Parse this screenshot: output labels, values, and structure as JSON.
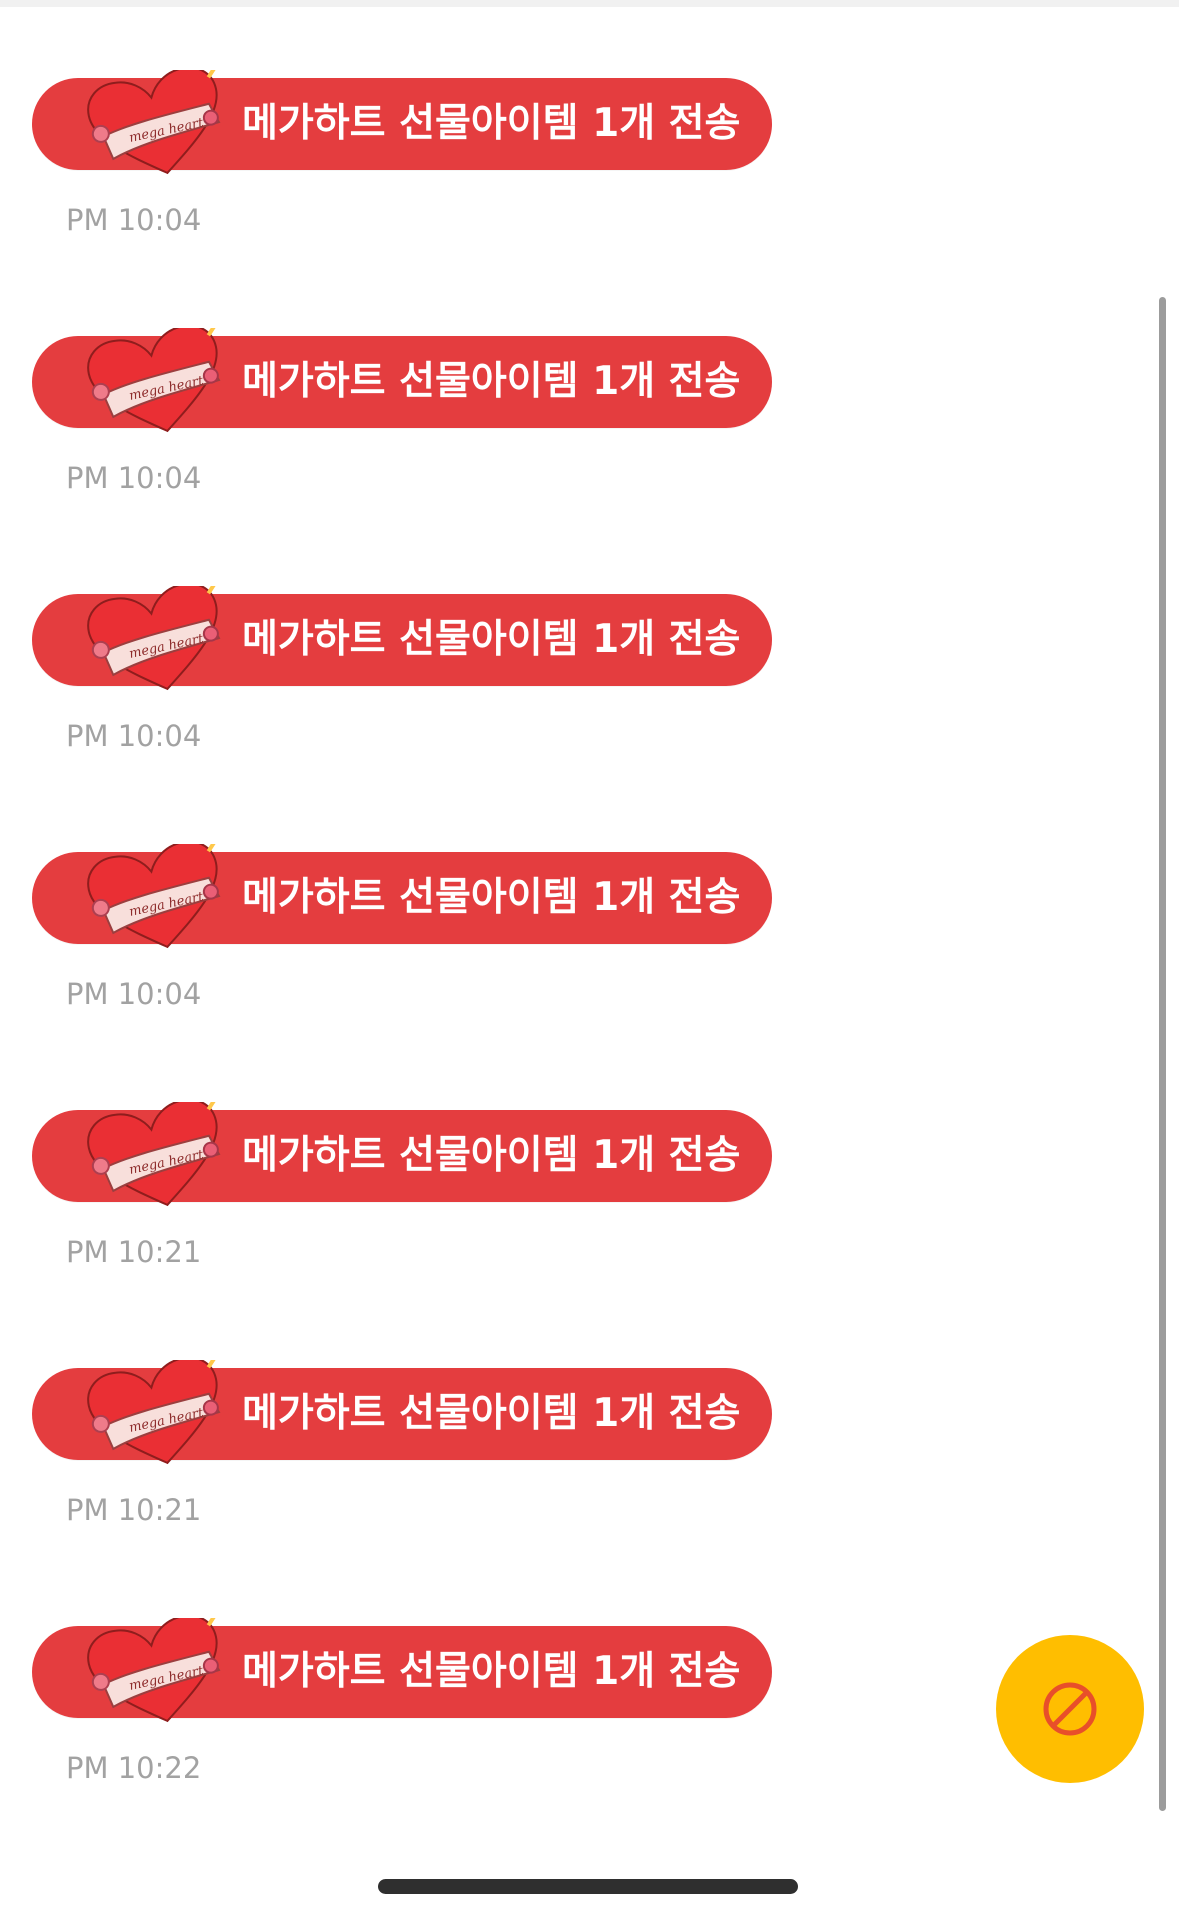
{
  "messages": [
    {
      "label": "메가하트 선물아이템 1개 전송",
      "time": "PM 10:04"
    },
    {
      "label": "메가하트 선물아이템 1개 전송",
      "time": "PM 10:04"
    },
    {
      "label": "메가하트 선물아이템 1개 전송",
      "time": "PM 10:04"
    },
    {
      "label": "메가하트 선물아이템 1개 전송",
      "time": "PM 10:04"
    },
    {
      "label": "메가하트 선물아이템 1개 전송",
      "time": "PM 10:21"
    },
    {
      "label": "메가하트 선물아이템 1개 전송",
      "time": "PM 10:21"
    },
    {
      "label": "메가하트 선물아이템 1개 전송",
      "time": "PM 10:22"
    }
  ],
  "sticker_lettering": "mega heart",
  "block_button_icon": "prohibited-icon",
  "colors": {
    "bubble": "#e43d3f",
    "fab": "#ffbe00",
    "timestamp": "#a2a2a2",
    "scrollbar": "#9c9c9c"
  }
}
